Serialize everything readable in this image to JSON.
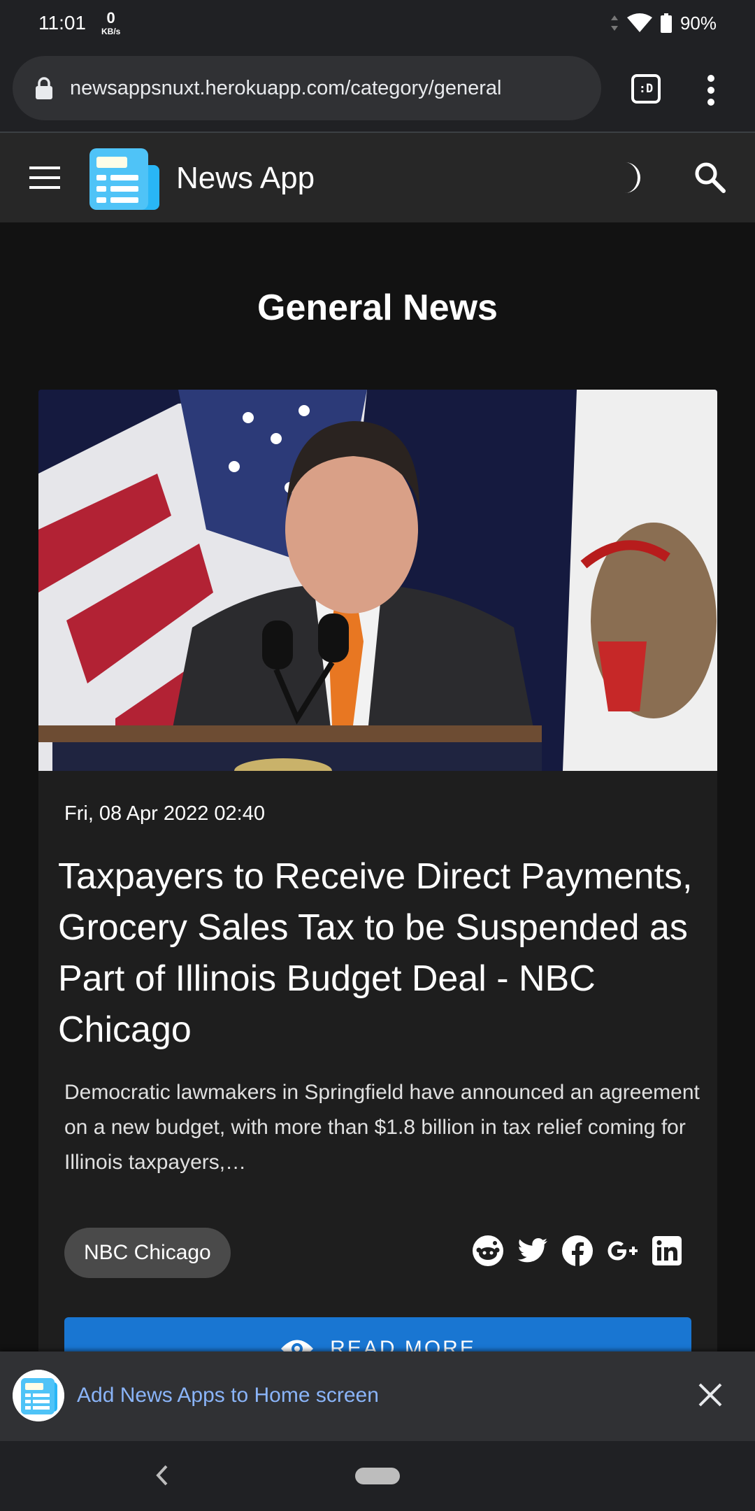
{
  "status_bar": {
    "time": "11:01",
    "net_speed_value": "0",
    "net_speed_unit": "KB/s",
    "battery": "90%"
  },
  "browser": {
    "url": "newsappsnuxt.herokuapp.com/category/general",
    "tab_label": ":D"
  },
  "app_bar": {
    "title": "News App"
  },
  "page": {
    "heading": "General News"
  },
  "article": {
    "date": "Fri, 08 Apr 2022 02:40",
    "title": "Taxpayers to Receive Direct Payments, Grocery Sales Tax to be Suspended as Part of Illinois Budget Deal - NBC Chicago",
    "description": "Democratic lawmakers in Springfield have announced an agreement on a new budget, with more than $1.8 billion in tax relief coming for Illinois taxpayers,…",
    "source": "NBC Chicago",
    "read_more": "READ MORE",
    "share_icons": [
      "reddit-icon",
      "twitter-icon",
      "facebook-icon",
      "google-plus-icon",
      "linkedin-icon"
    ]
  },
  "install_banner": {
    "text": "Add News Apps to Home screen"
  },
  "colors": {
    "accent": "#1976d2",
    "banner_link": "#8ab4f8",
    "app_bar": "#272727",
    "card": "#1e1e1e"
  }
}
